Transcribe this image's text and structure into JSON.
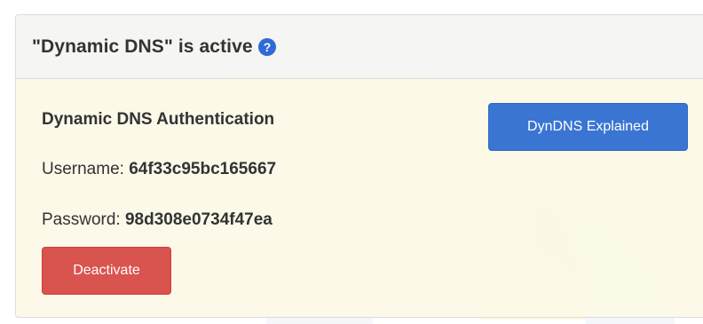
{
  "panel": {
    "title": "\"Dynamic DNS\" is active",
    "help_icon": "question-circle-icon",
    "auth_heading": "Dynamic DNS Authentication",
    "username_label": "Username: ",
    "username_value": "64f33c95bc165667",
    "password_label": "Password: ",
    "password_value": "98d308e0734f47ea",
    "deactivate_label": "Deactivate",
    "explained_label": "DynDNS Explained"
  },
  "colors": {
    "accent_blue": "#3a75d4",
    "danger_red": "#d9534f",
    "help_icon_blue": "#2e6bd6",
    "panel_bg": "#fcf8e6",
    "heading_bg": "#f5f5f5"
  }
}
